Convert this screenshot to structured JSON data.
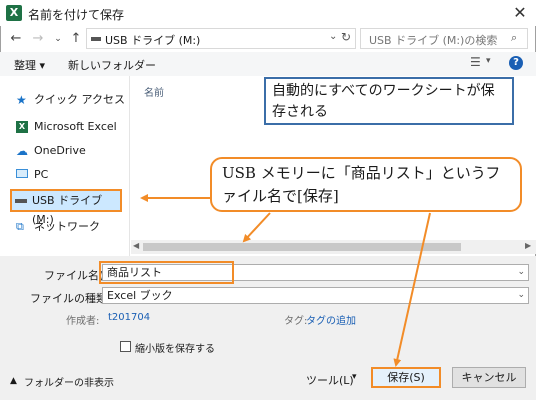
{
  "window": {
    "title": "名前を付けて保存",
    "app_icon_letter": "X"
  },
  "address_bar": {
    "path": "USB ドライブ (M:)",
    "search_placeholder": "USB ドライブ (M:)の検索"
  },
  "toolbar": {
    "organize": "整理 ▾",
    "new_folder": "新しいフォルダー",
    "help": "?"
  },
  "sidebar": {
    "items": [
      {
        "label": "クイック アクセス",
        "icon": "star-icon"
      },
      {
        "label": "Microsoft Excel",
        "icon": "excel-icon"
      },
      {
        "label": "OneDrive",
        "icon": "cloud-icon"
      },
      {
        "label": "PC",
        "icon": "computer-icon"
      },
      {
        "label": "USB ドライブ (M:)",
        "icon": "usb-drive-icon"
      },
      {
        "label": "ネットワーク",
        "icon": "network-icon"
      }
    ]
  },
  "file_list": {
    "column_name": "名前"
  },
  "form": {
    "filename_label": "ファイル名(N):",
    "filename_value": "商品リスト",
    "filetype_label": "ファイルの種類(T):",
    "filetype_value": "Excel ブック",
    "author_label": "作成者:",
    "author_value": "t201704",
    "tags_label": "タグ:",
    "tags_value": "タグの追加",
    "thumbnail_label": "縮小版を保存する"
  },
  "footer": {
    "hide_folders": "フォルダーの非表示",
    "tools": "ツール(L)",
    "save": "保存(S)",
    "cancel": "キャンセル"
  },
  "callouts": {
    "note1": "自動的にすべてのワークシートが保存される",
    "note2": "USB メモリーに「商品リスト」というファイル名で[保存]"
  },
  "colors": {
    "accent_orange": "#f28c28",
    "callout_blue": "#3b6ea8",
    "selection_blue": "#cce8ff"
  }
}
